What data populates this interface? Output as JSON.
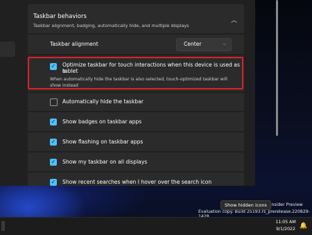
{
  "settings": {
    "section_title": "Taskbar behaviors",
    "section_subtitle": "Taskbar alignment, badging, automatically hide, and multiple displays",
    "alignment_label": "Taskbar alignment",
    "alignment_value": "Center",
    "options": [
      {
        "label": "Optimize taskbar for touch interactions when this device is used as a",
        "label2": "tablet",
        "checked": true,
        "sub1": "When automatically hide the taskbar is also selected, touch-optimized taskbar will",
        "sub2": "show instead"
      },
      {
        "label": "Automatically hide the taskbar",
        "checked": false
      },
      {
        "label": "Show badges on taskbar apps",
        "checked": true
      },
      {
        "label": "Show flashing on taskbar apps",
        "checked": true
      },
      {
        "label": "Show my taskbar on all displays",
        "checked": true
      },
      {
        "label": "Show recent searches when I hover over the search icon",
        "checked": true
      }
    ],
    "check_glyph": "✓",
    "chevron_up": "︿",
    "chevron_down": "⌵"
  },
  "desktop": {
    "watermark_line1": "1 Pro Insider Preview",
    "watermark_line2": "Evaluation copy. Build 25193.rs_prerelease.220829-1428",
    "tooltip": "Show hidden icons"
  },
  "taskbar": {
    "time": "11:05 AM",
    "date": "9/1/2022"
  },
  "colors": {
    "accent": "#4cc2ff",
    "highlight_box": "#e0202a"
  }
}
